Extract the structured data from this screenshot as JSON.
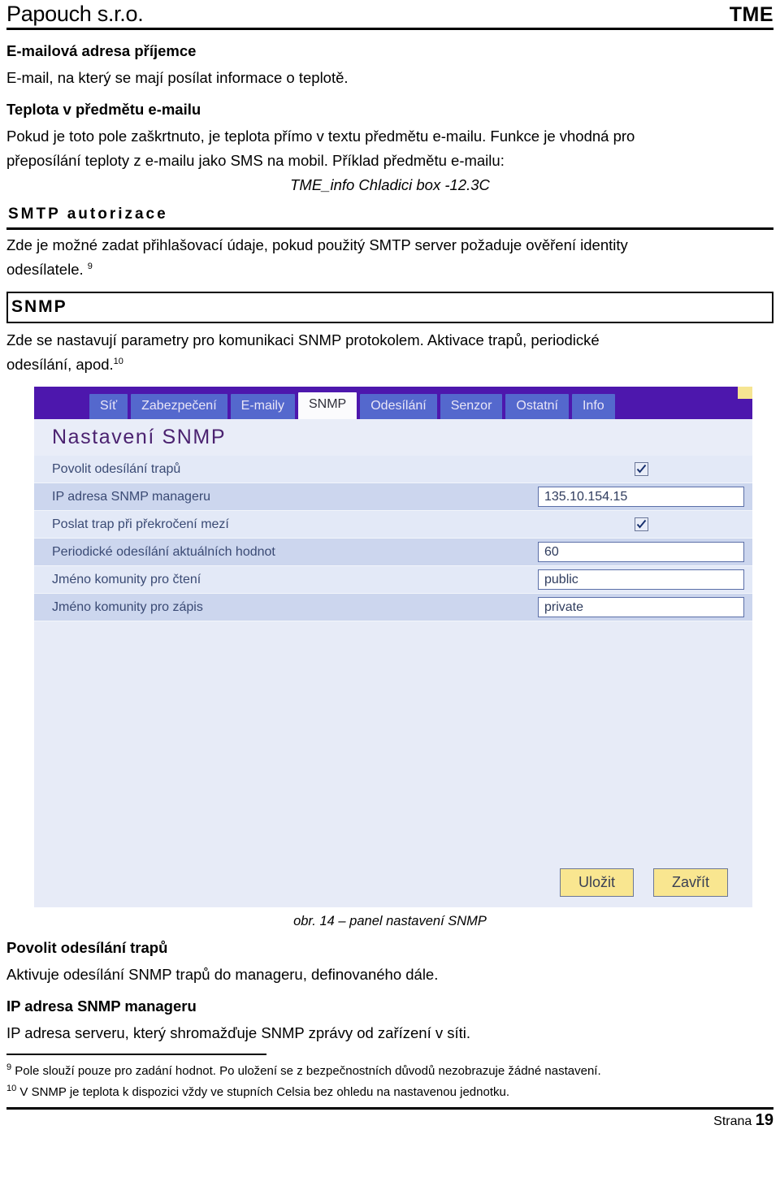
{
  "header": {
    "company": "Papouch s.r.o.",
    "product": "TME"
  },
  "sections": {
    "email_recipient": {
      "term": "E-mailová adresa příjemce",
      "desc": "E-mail, na který se mají posílat informace o teplotě."
    },
    "temp_in_subject": {
      "term": "Teplota v předmětu e-mailu",
      "desc_line1": "Pokud je toto pole zaškrtnuto, je teplota přímo v textu předmětu e-mailu. Funkce je vhodná pro",
      "desc_line2": "přeposílání teploty z e-mailu jako SMS na mobil. Příklad předmětu e-mailu:",
      "example": "TME_info Chladici box -12.3C"
    },
    "smtp": {
      "heading": "SMTP autorizace",
      "desc_line1": "Zde je možné zadat přihlašovací údaje, pokud použitý SMTP server požaduje ověření identity",
      "desc_line2": "odesílatele.",
      "footnote_ref": "9"
    },
    "snmp": {
      "heading": "SNMP",
      "desc_line1": "Zde se nastavují parametry pro komunikaci SNMP protokolem. Aktivace trapů, periodické",
      "desc_line2": "odesílání, apod.",
      "footnote_ref": "10"
    }
  },
  "screenshot": {
    "tabs": [
      {
        "label": "Síť",
        "active": false
      },
      {
        "label": "Zabezpečení",
        "active": false
      },
      {
        "label": "E-maily",
        "active": false
      },
      {
        "label": "SNMP",
        "active": true
      },
      {
        "label": "Odesílání",
        "active": false
      },
      {
        "label": "Senzor",
        "active": false
      },
      {
        "label": "Ostatní",
        "active": false
      },
      {
        "label": "Info",
        "active": false
      }
    ],
    "panel_title": "Nastavení SNMP",
    "rows": [
      {
        "label": "Povolit odesílání trapů",
        "type": "checkbox",
        "value": "checked"
      },
      {
        "label": "IP adresa SNMP manageru",
        "type": "text",
        "value": "135.10.154.15"
      },
      {
        "label": "Poslat trap při překročení mezí",
        "type": "checkbox",
        "value": "checked"
      },
      {
        "label": "Periodické odesílání aktuálních hodnot",
        "type": "text",
        "value": "60"
      },
      {
        "label": "Jméno komunity pro čtení",
        "type": "text",
        "value": "public"
      },
      {
        "label": "Jméno komunity pro zápis",
        "type": "text",
        "value": "private"
      }
    ],
    "buttons": {
      "save": "Uložit",
      "close": "Zavřít"
    },
    "colors": {
      "tabbar": "#4d17ad",
      "tab": "#5468cd",
      "tab_active": "#fbfbfd",
      "panel_bg": "#e7ebf7",
      "row_alt": "#ccd6ee",
      "title_text": "#4b2270",
      "button": "#f9e690",
      "corner_marker": "#f6e592"
    }
  },
  "caption": "obr. 14 – panel nastavení SNMP",
  "glossary": {
    "term1": "Povolit odesílání trapů",
    "desc1": "Aktivuje odesílání SNMP trapů do manageru, definovaného dále.",
    "term2": "IP adresa SNMP manageru",
    "desc2": "IP adresa serveru, který shromažďuje SNMP zprávy od zařízení v síti."
  },
  "footnotes": [
    {
      "num": "9",
      "text": " Pole slouží pouze pro zadání hodnot. Po uložení se z bezpečnostních důvodů nezobrazuje žádné nastavení."
    },
    {
      "num": "10",
      "text": " V SNMP je teplota k dispozici vždy ve stupních Celsia bez ohledu na nastavenou jednotku."
    }
  ],
  "footer": {
    "page_label": "Strana",
    "page_number": "19"
  }
}
